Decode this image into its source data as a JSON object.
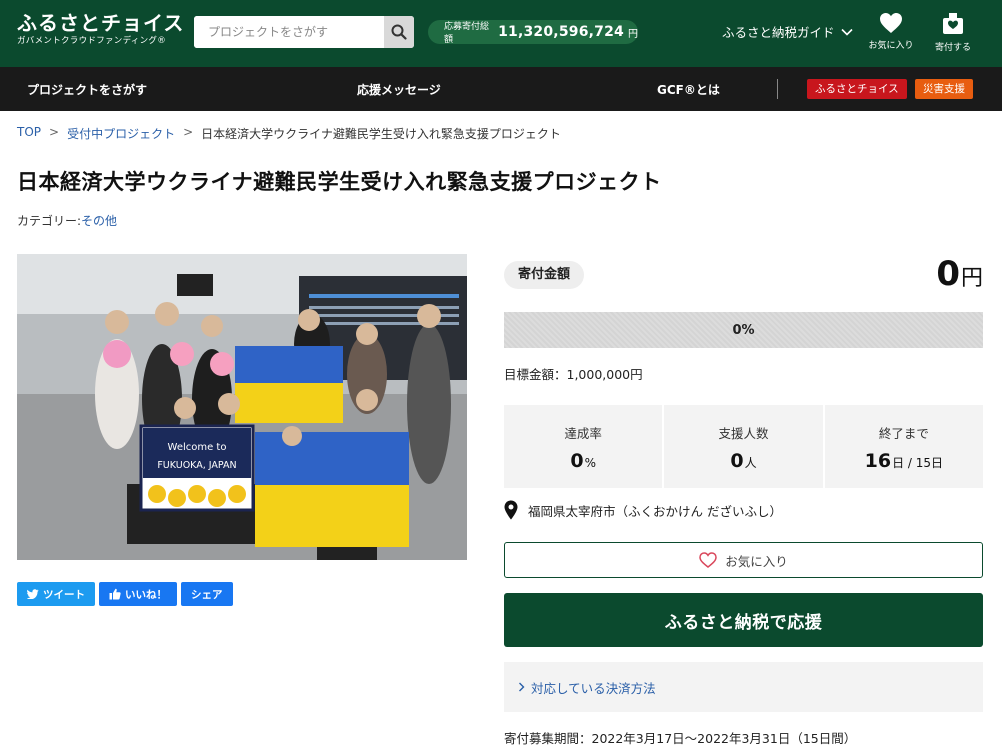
{
  "header": {
    "logo_main": "ふるさとチョイス",
    "logo_sub": "ガバメントクラウドファンディング®",
    "search_placeholder": "プロジェクトをさがす",
    "total_label": "応募寄付総額",
    "total_value": "11,320,596,724",
    "total_unit": "円",
    "guide_label": "ふるさと納税ガイド",
    "favorites_label": "お気に入り",
    "donate_label": "寄付する"
  },
  "nav": {
    "items": [
      "プロジェクトをさがす",
      "応援メッセージ",
      "GCF®とは"
    ],
    "furusato_choice": "ふるさとチョイス",
    "disaster_support": "災害支援",
    "furusato_color": "#c8161d",
    "disaster_color": "#e85d10"
  },
  "breadcrumb": {
    "top": "TOP",
    "sep": ">",
    "accepting": "受付中プロジェクト",
    "current": "日本経済大学ウクライナ避難民学生受け入れ緊急支援プロジェクト"
  },
  "page": {
    "title": "日本経済大学ウクライナ避難民学生受け入れ緊急支援プロジェクト",
    "category_label": "カテゴリー:",
    "category_value": "その他"
  },
  "photo": {
    "sign_line1": "Welcome to",
    "sign_line2": "FUKUOKA, JAPAN"
  },
  "share": {
    "tweet": "ツイート",
    "like": "いいね！",
    "share": "シェア"
  },
  "project": {
    "donation_badge": "寄付金額",
    "amount": "0",
    "amount_unit": "円",
    "progress_text": "0%",
    "progress_fraction": 0,
    "goal": "目標金額：1,000,000円",
    "stats": [
      {
        "label": "達成率",
        "value": "0",
        "unit": "%"
      },
      {
        "label": "支援人数",
        "value": "0",
        "unit": "人"
      },
      {
        "label": "終了まで",
        "value": "16",
        "unit": "日 / 15日"
      }
    ],
    "location": "福岡県太宰府市（ふくおかけん だざいふし）",
    "favorite_button": "お気に入り",
    "support_button": "ふるさと納税で応援",
    "payment_link": "対応している決済方法",
    "period": "寄付募集期間：2022年3月17日〜2022年3月31日（15日間）"
  }
}
